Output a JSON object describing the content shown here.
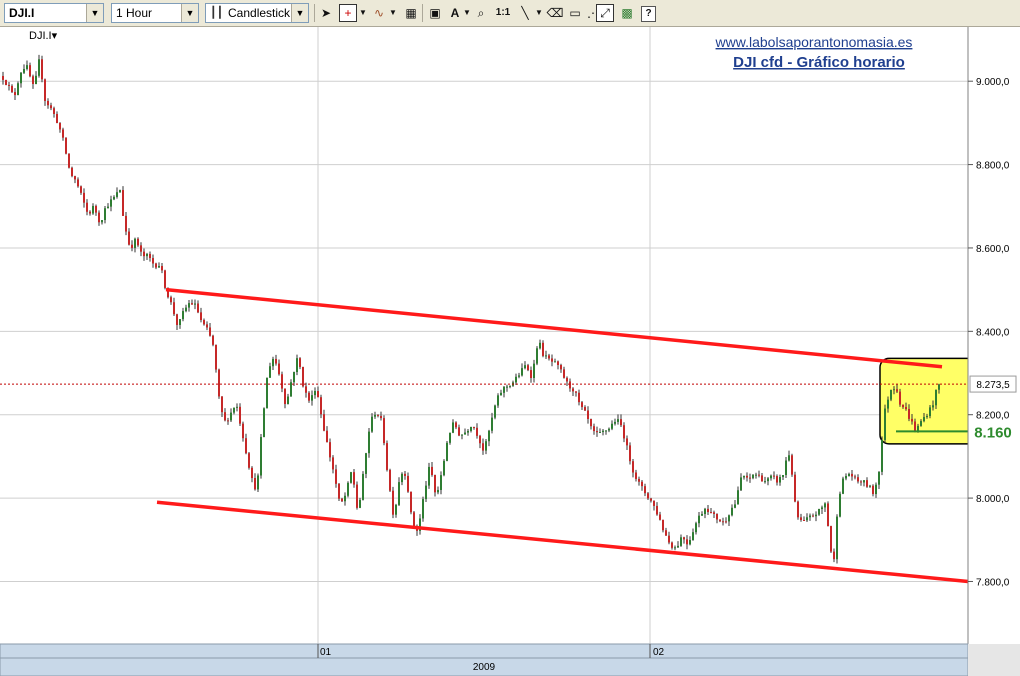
{
  "toolbar": {
    "symbol": "DJI.I",
    "interval": "1 Hour",
    "chart_style": "Candlestick",
    "zoom_label": "1:1",
    "help_label": "?"
  },
  "chart_header": {
    "symbol_label": "DJI.I▾",
    "website": "www.labolsaporantonomasia.es",
    "title": "DJI cfd - Gráfico horario"
  },
  "colors": {
    "channel_line": "#ff1a1a",
    "up_candle": "#2e7d32",
    "down_candle": "#c62828",
    "support_line": "#2e8b2e",
    "highlight_fill": "#ffff66",
    "price_marker": "#c00000"
  },
  "chart_data": {
    "type": "candlestick",
    "title": "DJI cfd - Gráfico horario",
    "xlabel": "",
    "ylabel": "",
    "ylim": [
      7650,
      9130
    ],
    "y_ticks": [
      "7.800,0",
      "8.000,0",
      "8.200,0",
      "8.400,0",
      "8.600,0",
      "8.800,0",
      "9.000,0"
    ],
    "y_tick_values": [
      7800,
      8000,
      8200,
      8400,
      8600,
      8800,
      9000
    ],
    "x_ticks": [
      "01",
      "02"
    ],
    "x_year_label": "2009",
    "last_price": 8273.5,
    "last_price_label": "8.273,5",
    "support_value": 8160,
    "support_label": "8.160",
    "close_path": [
      [
        0,
        9020
      ],
      [
        8,
        8990
      ],
      [
        14,
        8960
      ],
      [
        20,
        9020
      ],
      [
        26,
        9040
      ],
      [
        34,
        8980
      ],
      [
        40,
        9060
      ],
      [
        44,
        8960
      ],
      [
        52,
        8930
      ],
      [
        58,
        8900
      ],
      [
        64,
        8850
      ],
      [
        70,
        8780
      ],
      [
        76,
        8760
      ],
      [
        82,
        8720
      ],
      [
        88,
        8680
      ],
      [
        94,
        8700
      ],
      [
        100,
        8660
      ],
      [
        106,
        8700
      ],
      [
        114,
        8720
      ],
      [
        120,
        8740
      ],
      [
        124,
        8660
      ],
      [
        130,
        8600
      ],
      [
        136,
        8620
      ],
      [
        142,
        8580
      ],
      [
        148,
        8580
      ],
      [
        154,
        8560
      ],
      [
        160,
        8560
      ],
      [
        166,
        8500
      ],
      [
        172,
        8460
      ],
      [
        178,
        8410
      ],
      [
        184,
        8450
      ],
      [
        190,
        8470
      ],
      [
        196,
        8460
      ],
      [
        202,
        8420
      ],
      [
        208,
        8400
      ],
      [
        214,
        8360
      ],
      [
        218,
        8250
      ],
      [
        224,
        8180
      ],
      [
        230,
        8200
      ],
      [
        236,
        8230
      ],
      [
        242,
        8160
      ],
      [
        248,
        8090
      ],
      [
        254,
        8020
      ],
      [
        258,
        8050
      ],
      [
        262,
        8170
      ],
      [
        268,
        8310
      ],
      [
        274,
        8340
      ],
      [
        280,
        8290
      ],
      [
        286,
        8220
      ],
      [
        292,
        8290
      ],
      [
        298,
        8340
      ],
      [
        304,
        8260
      ],
      [
        310,
        8230
      ],
      [
        316,
        8270
      ],
      [
        322,
        8190
      ],
      [
        328,
        8120
      ],
      [
        334,
        8060
      ],
      [
        340,
        7980
      ],
      [
        346,
        8010
      ],
      [
        352,
        8070
      ],
      [
        358,
        7960
      ],
      [
        364,
        8070
      ],
      [
        370,
        8180
      ],
      [
        376,
        8210
      ],
      [
        382,
        8180
      ],
      [
        388,
        8050
      ],
      [
        394,
        7950
      ],
      [
        400,
        8060
      ],
      [
        406,
        8060
      ],
      [
        412,
        7940
      ],
      [
        418,
        7920
      ],
      [
        424,
        8010
      ],
      [
        430,
        8080
      ],
      [
        436,
        8000
      ],
      [
        442,
        8060
      ],
      [
        448,
        8150
      ],
      [
        454,
        8180
      ],
      [
        460,
        8150
      ],
      [
        466,
        8160
      ],
      [
        472,
        8180
      ],
      [
        478,
        8150
      ],
      [
        484,
        8110
      ],
      [
        490,
        8170
      ],
      [
        496,
        8230
      ],
      [
        502,
        8260
      ],
      [
        508,
        8270
      ],
      [
        514,
        8280
      ],
      [
        520,
        8300
      ],
      [
        526,
        8320
      ],
      [
        532,
        8290
      ],
      [
        538,
        8380
      ],
      [
        544,
        8340
      ],
      [
        550,
        8330
      ],
      [
        556,
        8320
      ],
      [
        562,
        8300
      ],
      [
        568,
        8270
      ],
      [
        574,
        8260
      ],
      [
        580,
        8220
      ],
      [
        586,
        8200
      ],
      [
        592,
        8160
      ],
      [
        598,
        8150
      ],
      [
        604,
        8160
      ],
      [
        610,
        8170
      ],
      [
        616,
        8190
      ],
      [
        622,
        8170
      ],
      [
        628,
        8110
      ],
      [
        634,
        8060
      ],
      [
        640,
        8030
      ],
      [
        646,
        8010
      ],
      [
        652,
        7990
      ],
      [
        658,
        7960
      ],
      [
        664,
        7920
      ],
      [
        670,
        7890
      ],
      [
        676,
        7880
      ],
      [
        682,
        7910
      ],
      [
        688,
        7890
      ],
      [
        694,
        7930
      ],
      [
        700,
        7960
      ],
      [
        706,
        7980
      ],
      [
        712,
        7960
      ],
      [
        718,
        7950
      ],
      [
        724,
        7940
      ],
      [
        730,
        7970
      ],
      [
        736,
        7990
      ],
      [
        742,
        8060
      ],
      [
        748,
        8040
      ],
      [
        754,
        8060
      ],
      [
        760,
        8050
      ],
      [
        766,
        8040
      ],
      [
        772,
        8050
      ],
      [
        778,
        8040
      ],
      [
        784,
        8060
      ],
      [
        788,
        8120
      ],
      [
        792,
        8060
      ],
      [
        796,
        7960
      ],
      [
        802,
        7940
      ],
      [
        808,
        7950
      ],
      [
        814,
        7960
      ],
      [
        820,
        7970
      ],
      [
        826,
        7990
      ],
      [
        830,
        7880
      ],
      [
        834,
        7850
      ],
      [
        838,
        8000
      ],
      [
        844,
        8050
      ],
      [
        850,
        8060
      ],
      [
        856,
        8040
      ],
      [
        862,
        8040
      ],
      [
        868,
        8030
      ],
      [
        874,
        8010
      ],
      [
        880,
        8080
      ],
      [
        884,
        8200
      ],
      [
        890,
        8260
      ],
      [
        896,
        8270
      ],
      [
        900,
        8230
      ],
      [
        906,
        8210
      ],
      [
        912,
        8180
      ],
      [
        916,
        8160
      ],
      [
        920,
        8180
      ],
      [
        926,
        8200
      ],
      [
        932,
        8220
      ],
      [
        938,
        8270
      ],
      [
        942,
        8280
      ]
    ],
    "channel_upper": [
      [
        166,
        8500
      ],
      [
        942,
        8315
      ]
    ],
    "channel_lower": [
      [
        157,
        7990
      ],
      [
        968,
        7800
      ]
    ],
    "support_segment": [
      [
        896,
        8160
      ],
      [
        968,
        8160
      ]
    ],
    "highlight_box": [
      [
        880,
        8335
      ],
      [
        1016,
        8130
      ]
    ]
  }
}
